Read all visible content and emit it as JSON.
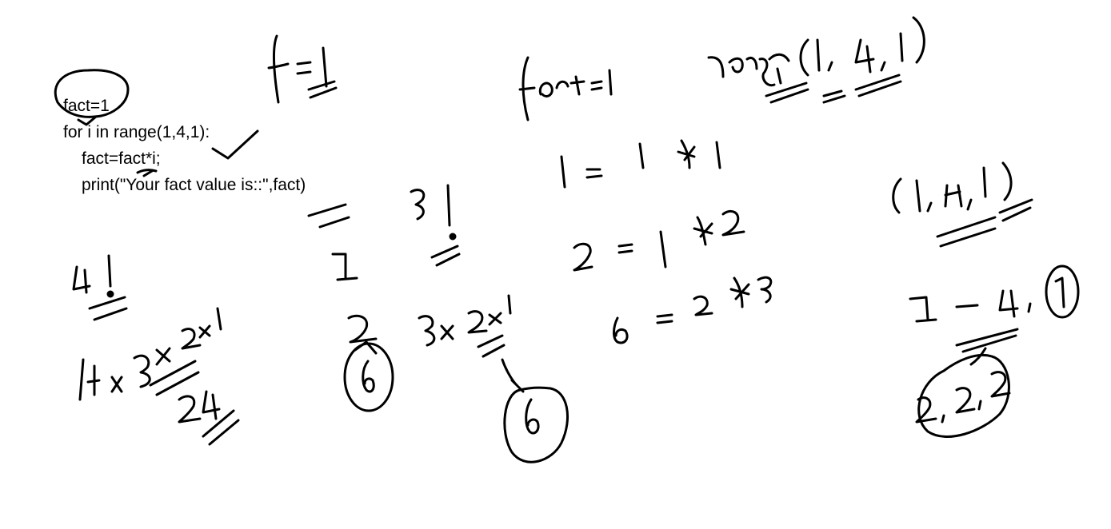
{
  "code": {
    "line1": "fact=1",
    "line2": "for i in range(1,4,1):",
    "line3": "fact=fact*i;",
    "line4": "print(\"Your fact value is::\",fact)"
  }
}
